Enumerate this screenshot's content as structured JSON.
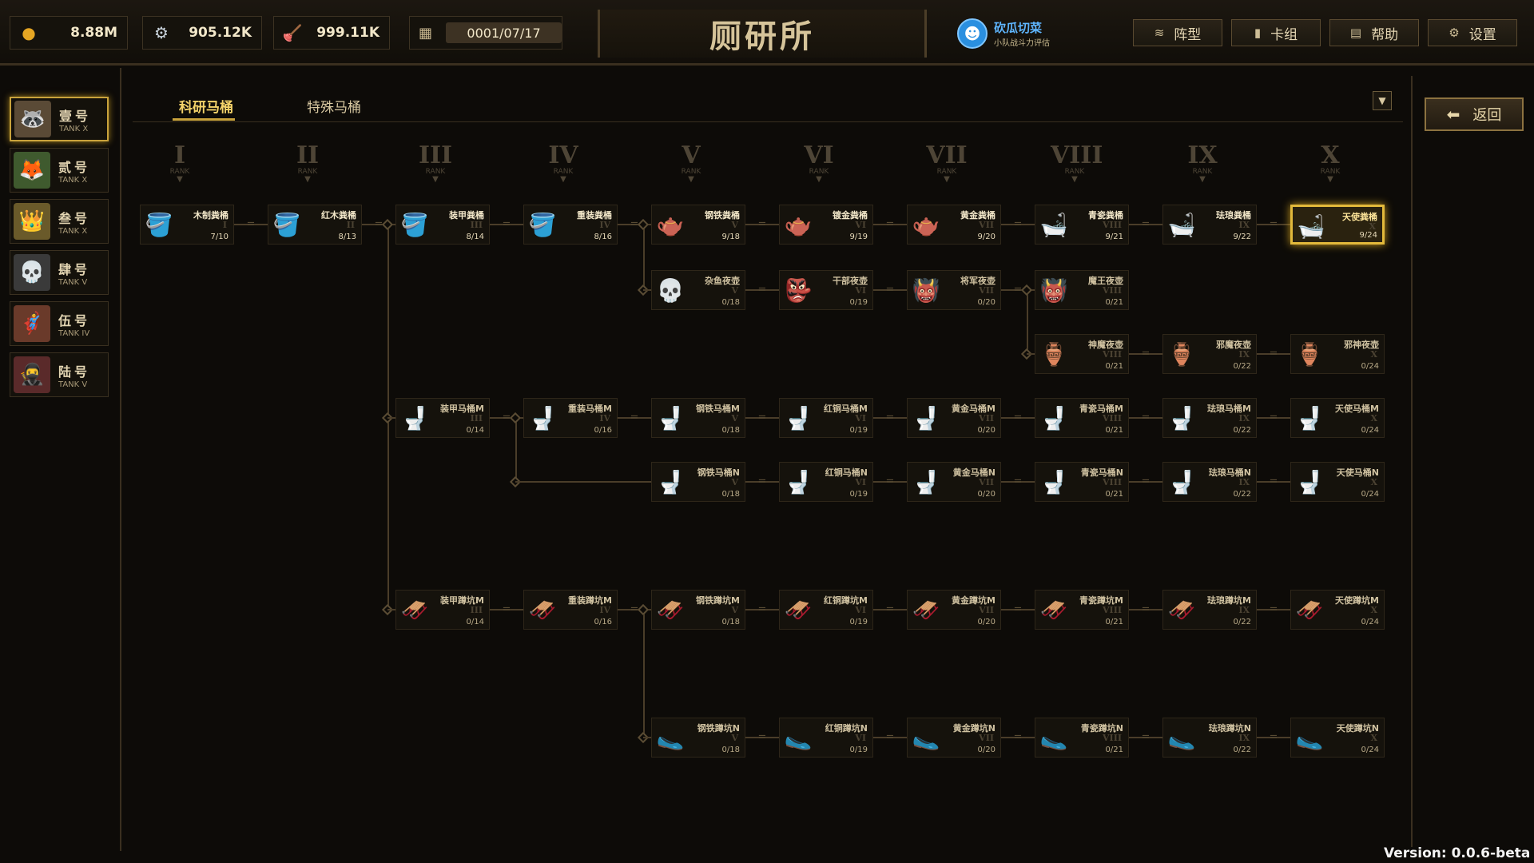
{
  "resources": [
    {
      "icon": "coin-icon",
      "glyph": "●",
      "value": "8.88M",
      "color": "#e6a623"
    },
    {
      "icon": "screw-icon",
      "glyph": "⚙",
      "value": "905.12K",
      "color": "#c9d3dc"
    },
    {
      "icon": "plunger-icon",
      "glyph": "🪠",
      "value": "999.11K",
      "color": "#e04a3a"
    }
  ],
  "date": {
    "icon": "calendar-icon",
    "value": "0001/07/17"
  },
  "title": "厕研所",
  "user": {
    "name": "砍瓜切菜",
    "subtitle": "小队战斗力评估"
  },
  "nav": [
    {
      "label": "阵型",
      "icon": "layers-icon",
      "glyph": "≋"
    },
    {
      "label": "卡组",
      "icon": "card-icon",
      "glyph": "▮"
    },
    {
      "label": "帮助",
      "icon": "help-book-icon",
      "glyph": "▤"
    },
    {
      "label": "设置",
      "icon": "settings-gear-icon",
      "glyph": "⚙"
    }
  ],
  "tanks": [
    {
      "name": "壹号",
      "sub": "TANK X",
      "glyph": "🦝",
      "bg": "#5a4a36"
    },
    {
      "name": "贰号",
      "sub": "TANK X",
      "glyph": "🦊",
      "bg": "#3f5a2e"
    },
    {
      "name": "叁号",
      "sub": "TANK X",
      "glyph": "👑",
      "bg": "#6a5a2a"
    },
    {
      "name": "肆号",
      "sub": "TANK V",
      "glyph": "💀",
      "bg": "#3a3a3a"
    },
    {
      "name": "伍号",
      "sub": "TANK IV",
      "glyph": "🦸",
      "bg": "#6a3a2a"
    },
    {
      "name": "陆号",
      "sub": "TANK V",
      "glyph": "🥷",
      "bg": "#5a2a2a"
    }
  ],
  "tabs": [
    "科研马桶",
    "特殊马桶"
  ],
  "back_label": "返回",
  "ranks": [
    "I",
    "II",
    "III",
    "IV",
    "V",
    "VI",
    "VII",
    "VIII",
    "IX",
    "X"
  ],
  "rank_label": "RANK",
  "rows": [
    {
      "cards": [
        {
          "col": 0,
          "name": "木制粪桶",
          "rank": "I",
          "level": "7/10",
          "glyph": "🪣"
        },
        {
          "col": 1,
          "name": "红木粪桶",
          "rank": "II",
          "level": "8/13",
          "glyph": "🪣"
        },
        {
          "col": 2,
          "name": "装甲粪桶",
          "rank": "III",
          "level": "8/14",
          "glyph": "🪣"
        },
        {
          "col": 3,
          "name": "重装粪桶",
          "rank": "IV",
          "level": "8/16",
          "glyph": "🪣"
        },
        {
          "col": 4,
          "name": "钢铁粪桶",
          "rank": "V",
          "level": "9/18",
          "glyph": "🫖"
        },
        {
          "col": 5,
          "name": "镀金粪桶",
          "rank": "VI",
          "level": "9/19",
          "glyph": "🫖"
        },
        {
          "col": 6,
          "name": "黄金粪桶",
          "rank": "VII",
          "level": "9/20",
          "glyph": "🫖"
        },
        {
          "col": 7,
          "name": "青瓷粪桶",
          "rank": "VIII",
          "level": "9/21",
          "glyph": "🛁"
        },
        {
          "col": 8,
          "name": "珐琅粪桶",
          "rank": "IX",
          "level": "9/22",
          "glyph": "🛁"
        },
        {
          "col": 9,
          "name": "天使粪桶",
          "rank": "X",
          "level": "9/24",
          "glyph": "🛁",
          "selected": true
        }
      ]
    },
    {
      "cards": [
        {
          "col": 4,
          "name": "杂鱼夜壶",
          "rank": "V",
          "level": "0/18",
          "glyph": "💀"
        },
        {
          "col": 5,
          "name": "干部夜壶",
          "rank": "VI",
          "level": "0/19",
          "glyph": "👺"
        },
        {
          "col": 6,
          "name": "将军夜壶",
          "rank": "VII",
          "level": "0/20",
          "glyph": "👹"
        },
        {
          "col": 7,
          "name": "魔王夜壶",
          "rank": "VIII",
          "level": "0/21",
          "glyph": "👹"
        }
      ]
    },
    {
      "cards": [
        {
          "col": 7,
          "name": "神魔夜壶",
          "rank": "VIII",
          "level": "0/21",
          "glyph": "🏺"
        },
        {
          "col": 8,
          "name": "邪魔夜壶",
          "rank": "IX",
          "level": "0/22",
          "glyph": "🏺"
        },
        {
          "col": 9,
          "name": "邪神夜壶",
          "rank": "X",
          "level": "0/24",
          "glyph": "🏺"
        }
      ]
    },
    {
      "cards": [
        {
          "col": 2,
          "name": "装甲马桶M",
          "rank": "III",
          "level": "0/14",
          "glyph": "🚽"
        },
        {
          "col": 3,
          "name": "重装马桶M",
          "rank": "IV",
          "level": "0/16",
          "glyph": "🚽"
        },
        {
          "col": 4,
          "name": "钢铁马桶M",
          "rank": "V",
          "level": "0/18",
          "glyph": "🚽"
        },
        {
          "col": 5,
          "name": "红铜马桶M",
          "rank": "VI",
          "level": "0/19",
          "glyph": "🚽"
        },
        {
          "col": 6,
          "name": "黄金马桶M",
          "rank": "VII",
          "level": "0/20",
          "glyph": "🚽"
        },
        {
          "col": 7,
          "name": "青瓷马桶M",
          "rank": "VIII",
          "level": "0/21",
          "glyph": "🚽"
        },
        {
          "col": 8,
          "name": "珐琅马桶M",
          "rank": "IX",
          "level": "0/22",
          "glyph": "🚽"
        },
        {
          "col": 9,
          "name": "天使马桶M",
          "rank": "X",
          "level": "0/24",
          "glyph": "🚽"
        }
      ]
    },
    {
      "cards": [
        {
          "col": 4,
          "name": "钢铁马桶N",
          "rank": "V",
          "level": "0/18",
          "glyph": "🚽"
        },
        {
          "col": 5,
          "name": "红铜马桶N",
          "rank": "VI",
          "level": "0/19",
          "glyph": "🚽"
        },
        {
          "col": 6,
          "name": "黄金马桶N",
          "rank": "VII",
          "level": "0/20",
          "glyph": "🚽"
        },
        {
          "col": 7,
          "name": "青瓷马桶N",
          "rank": "VIII",
          "level": "0/21",
          "glyph": "🚽"
        },
        {
          "col": 8,
          "name": "珐琅马桶N",
          "rank": "IX",
          "level": "0/22",
          "glyph": "🚽"
        },
        {
          "col": 9,
          "name": "天使马桶N",
          "rank": "X",
          "level": "0/24",
          "glyph": "🚽"
        }
      ]
    },
    {
      "cards": [
        {
          "col": 2,
          "name": "装甲蹲坑M",
          "rank": "III",
          "level": "0/14",
          "glyph": "🛷"
        },
        {
          "col": 3,
          "name": "重装蹲坑M",
          "rank": "IV",
          "level": "0/16",
          "glyph": "🛷"
        },
        {
          "col": 4,
          "name": "钢铁蹲坑M",
          "rank": "V",
          "level": "0/18",
          "glyph": "🛷"
        },
        {
          "col": 5,
          "name": "红铜蹲坑M",
          "rank": "VI",
          "level": "0/19",
          "glyph": "🛷"
        },
        {
          "col": 6,
          "name": "黄金蹲坑M",
          "rank": "VII",
          "level": "0/20",
          "glyph": "🛷"
        },
        {
          "col": 7,
          "name": "青瓷蹲坑M",
          "rank": "VIII",
          "level": "0/21",
          "glyph": "🛷"
        },
        {
          "col": 8,
          "name": "珐琅蹲坑M",
          "rank": "IX",
          "level": "0/22",
          "glyph": "🛷"
        },
        {
          "col": 9,
          "name": "天使蹲坑M",
          "rank": "X",
          "level": "0/24",
          "glyph": "🛷"
        }
      ]
    },
    {
      "cards": [
        {
          "col": 4,
          "name": "钢铁蹲坑N",
          "rank": "V",
          "level": "0/18",
          "glyph": "🥿"
        },
        {
          "col": 5,
          "name": "红铜蹲坑N",
          "rank": "VI",
          "level": "0/19",
          "glyph": "🥿"
        },
        {
          "col": 6,
          "name": "黄金蹲坑N",
          "rank": "VII",
          "level": "0/20",
          "glyph": "🥿"
        },
        {
          "col": 7,
          "name": "青瓷蹲坑N",
          "rank": "VIII",
          "level": "0/21",
          "glyph": "🥿"
        },
        {
          "col": 8,
          "name": "珐琅蹲坑N",
          "rank": "IX",
          "level": "0/22",
          "glyph": "🥿"
        },
        {
          "col": 9,
          "name": "天使蹲坑N",
          "rank": "X",
          "level": "0/24",
          "glyph": "🥿"
        }
      ]
    }
  ],
  "version": "Version:  0.0.6-beta"
}
